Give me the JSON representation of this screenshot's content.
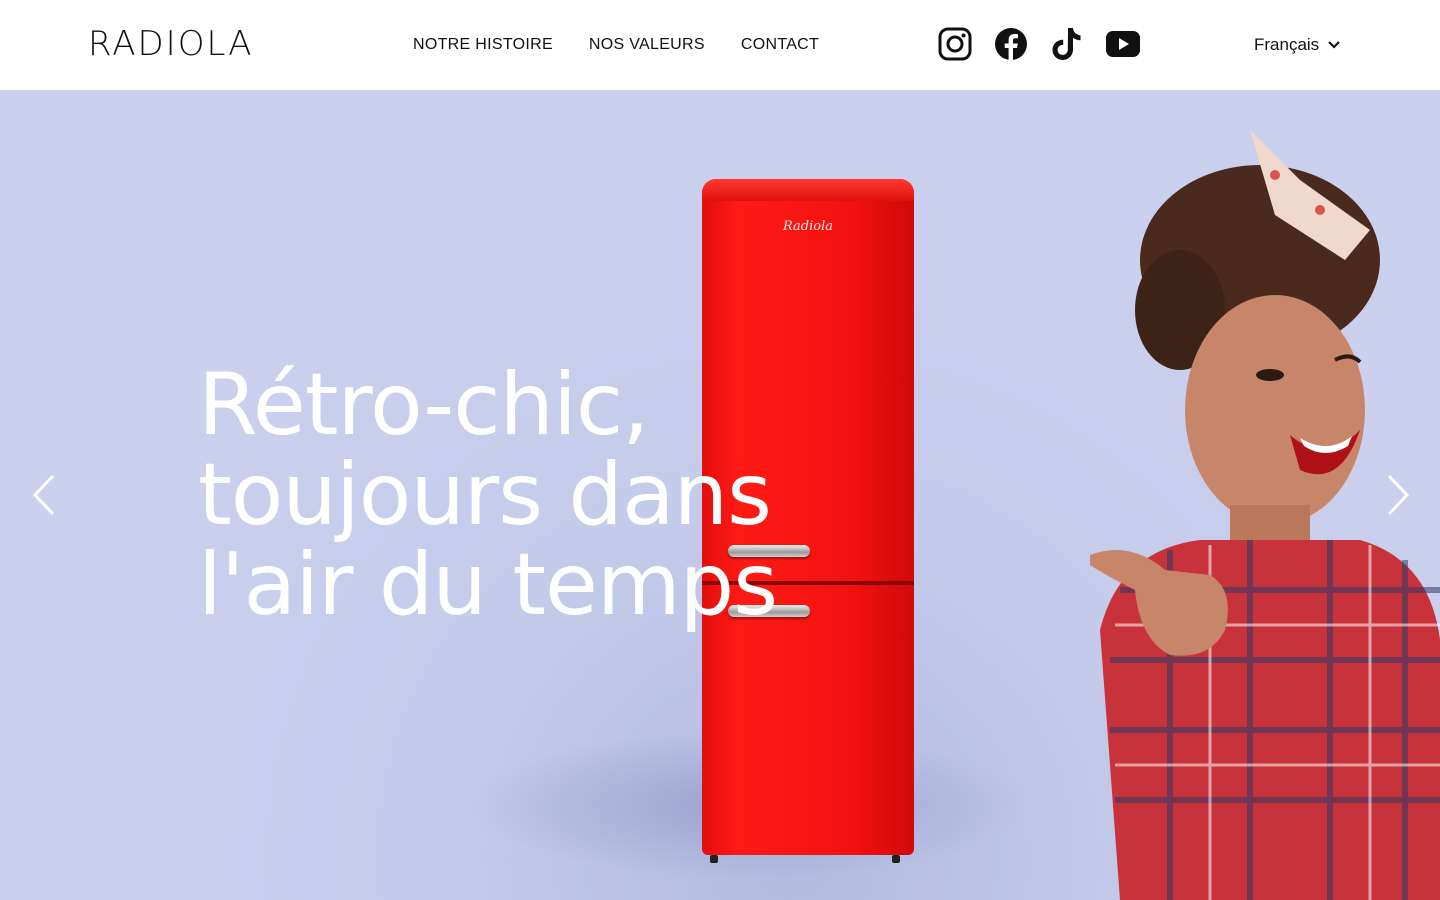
{
  "header": {
    "logo_text": "RADIOLA",
    "nav": [
      {
        "label": "NOTRE HISTOIRE"
      },
      {
        "label": "NOS VALEURS"
      },
      {
        "label": "CONTACT"
      }
    ],
    "socials": [
      {
        "icon": "instagram-icon"
      },
      {
        "icon": "facebook-icon"
      },
      {
        "icon": "tiktok-icon"
      },
      {
        "icon": "youtube-icon"
      }
    ],
    "language": "Français"
  },
  "hero": {
    "headline_lines": [
      "Rétro-chic,",
      "toujours dans",
      "l'air du temps"
    ],
    "fridge_brand": "Radiola",
    "colors": {
      "background": "#c9cfec",
      "fridge": "#f21210",
      "headline": "#ffffff"
    },
    "prev_icon": "chevron-left-icon",
    "next_icon": "chevron-right-icon"
  }
}
